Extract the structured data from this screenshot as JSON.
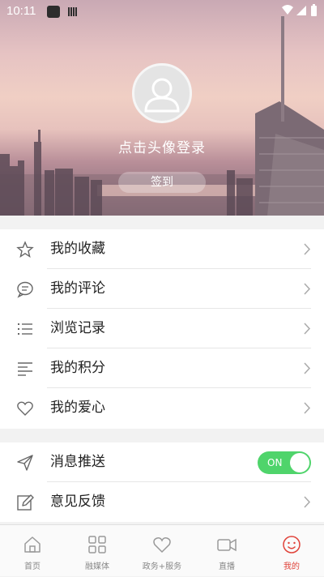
{
  "status_bar": {
    "time": "10:11"
  },
  "profile": {
    "login_prompt": "点击头像登录",
    "signin_label": "签到"
  },
  "menu_group_1": [
    {
      "label": "我的收藏",
      "icon": "star-icon"
    },
    {
      "label": "我的评论",
      "icon": "comment-icon"
    },
    {
      "label": "浏览记录",
      "icon": "list-icon"
    },
    {
      "label": "我的积分",
      "icon": "lines-icon"
    },
    {
      "label": "我的爱心",
      "icon": "heart-icon"
    }
  ],
  "menu_group_2": [
    {
      "label": "消息推送",
      "icon": "send-icon",
      "toggle": "ON"
    },
    {
      "label": "意见反馈",
      "icon": "edit-icon"
    }
  ],
  "tabbar": [
    {
      "label": "首页",
      "icon": "home-icon"
    },
    {
      "label": "融媒体",
      "icon": "grid-icon"
    },
    {
      "label": "政务+服务",
      "icon": "heart-hand-icon"
    },
    {
      "label": "直播",
      "icon": "video-icon"
    },
    {
      "label": "我的",
      "icon": "smile-icon",
      "active": true
    }
  ],
  "colors": {
    "accent": "#e0433a",
    "toggle_on": "#4fd46b"
  }
}
